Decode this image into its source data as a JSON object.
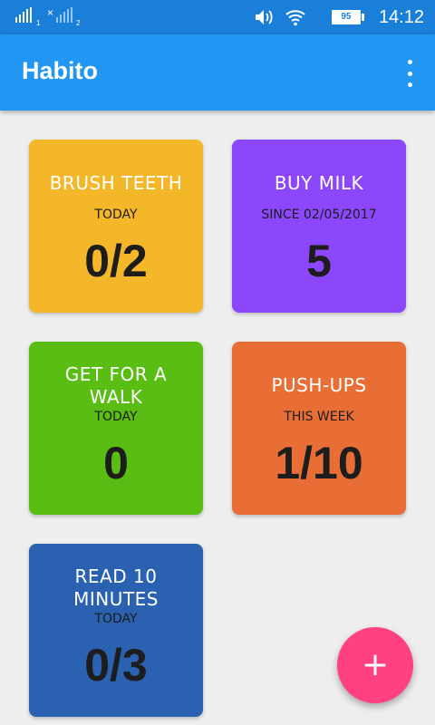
{
  "status_bar": {
    "sim1_label": "1",
    "sim2_label": "2",
    "sim2_x": "×",
    "battery": "95",
    "time": "14:12"
  },
  "app_bar": {
    "title": "Habito",
    "menu_icon": "more-vert-icon"
  },
  "habits": [
    {
      "title": "BRUSH TEETH",
      "period": "TODAY",
      "value": "0/2",
      "color": "#f4b72a"
    },
    {
      "title": "BUY MILK",
      "period": "SINCE 02/05/2017",
      "value": "5",
      "color": "#8c46fb"
    },
    {
      "title": "GET FOR A WALK",
      "period": "TODAY",
      "value": "0",
      "color": "#59bd13"
    },
    {
      "title": "PUSH-UPS",
      "period": "THIS WEEK",
      "value": "1/10",
      "color": "#e96e35"
    },
    {
      "title": "READ 10 MINUTES",
      "period": "TODAY",
      "value": "0/3",
      "color": "#2a61b1"
    }
  ],
  "fab": {
    "label": "+",
    "color": "#ff4081"
  }
}
